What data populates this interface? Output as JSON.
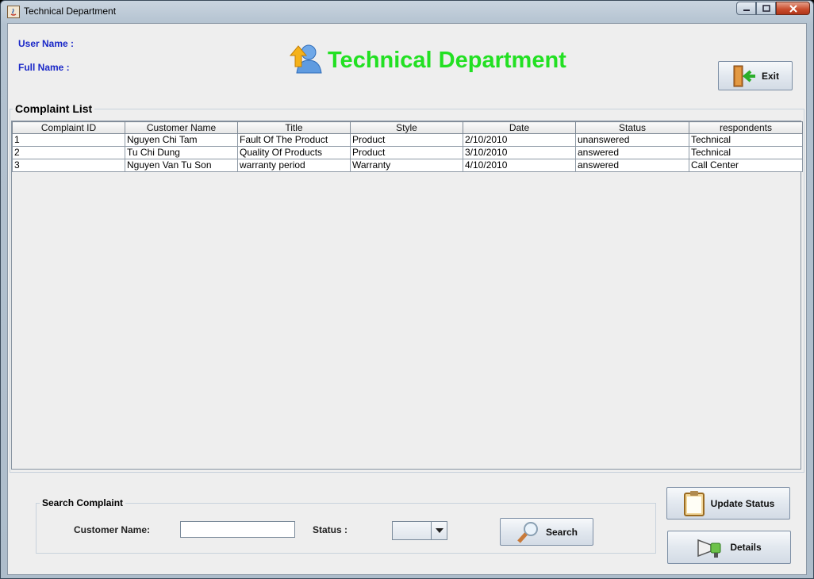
{
  "window": {
    "title": "Technical Department"
  },
  "header": {
    "user_name_label": "User Name :",
    "full_name_label": "Full Name :",
    "title": "Technical Department",
    "exit_label": "Exit"
  },
  "complaint_list": {
    "title": "Complaint List",
    "columns": [
      "Complaint ID",
      "Customer Name",
      "Title",
      "Style",
      "Date",
      "Status",
      "respondents"
    ],
    "rows": [
      [
        "1",
        "Nguyen Chi Tam",
        "Fault Of The Product",
        "Product",
        "2/10/2010",
        "unanswered",
        "Technical"
      ],
      [
        "2",
        "Tu Chi Dung",
        "Quality Of Products",
        "Product",
        "3/10/2010",
        "answered",
        "Technical"
      ],
      [
        "3",
        "Nguyen Van Tu Son",
        "warranty period",
        "Warranty",
        "4/10/2010",
        "answered",
        "Call Center"
      ]
    ]
  },
  "search": {
    "title": "Search Complaint",
    "customer_name_label": "Customer Name:",
    "customer_name_value": "",
    "status_label": "Status :",
    "status_value": "",
    "search_label": "Search"
  },
  "actions": {
    "update_status_label": "Update Status",
    "details_label": "Details"
  },
  "colors": {
    "title_green": "#22e022",
    "label_blue": "#1a28c8"
  },
  "icons": [
    "java-app-icon",
    "user-upload-icon",
    "exit-door-icon",
    "search-magnifier-icon",
    "clipboard-icon",
    "megaphone-icon"
  ]
}
